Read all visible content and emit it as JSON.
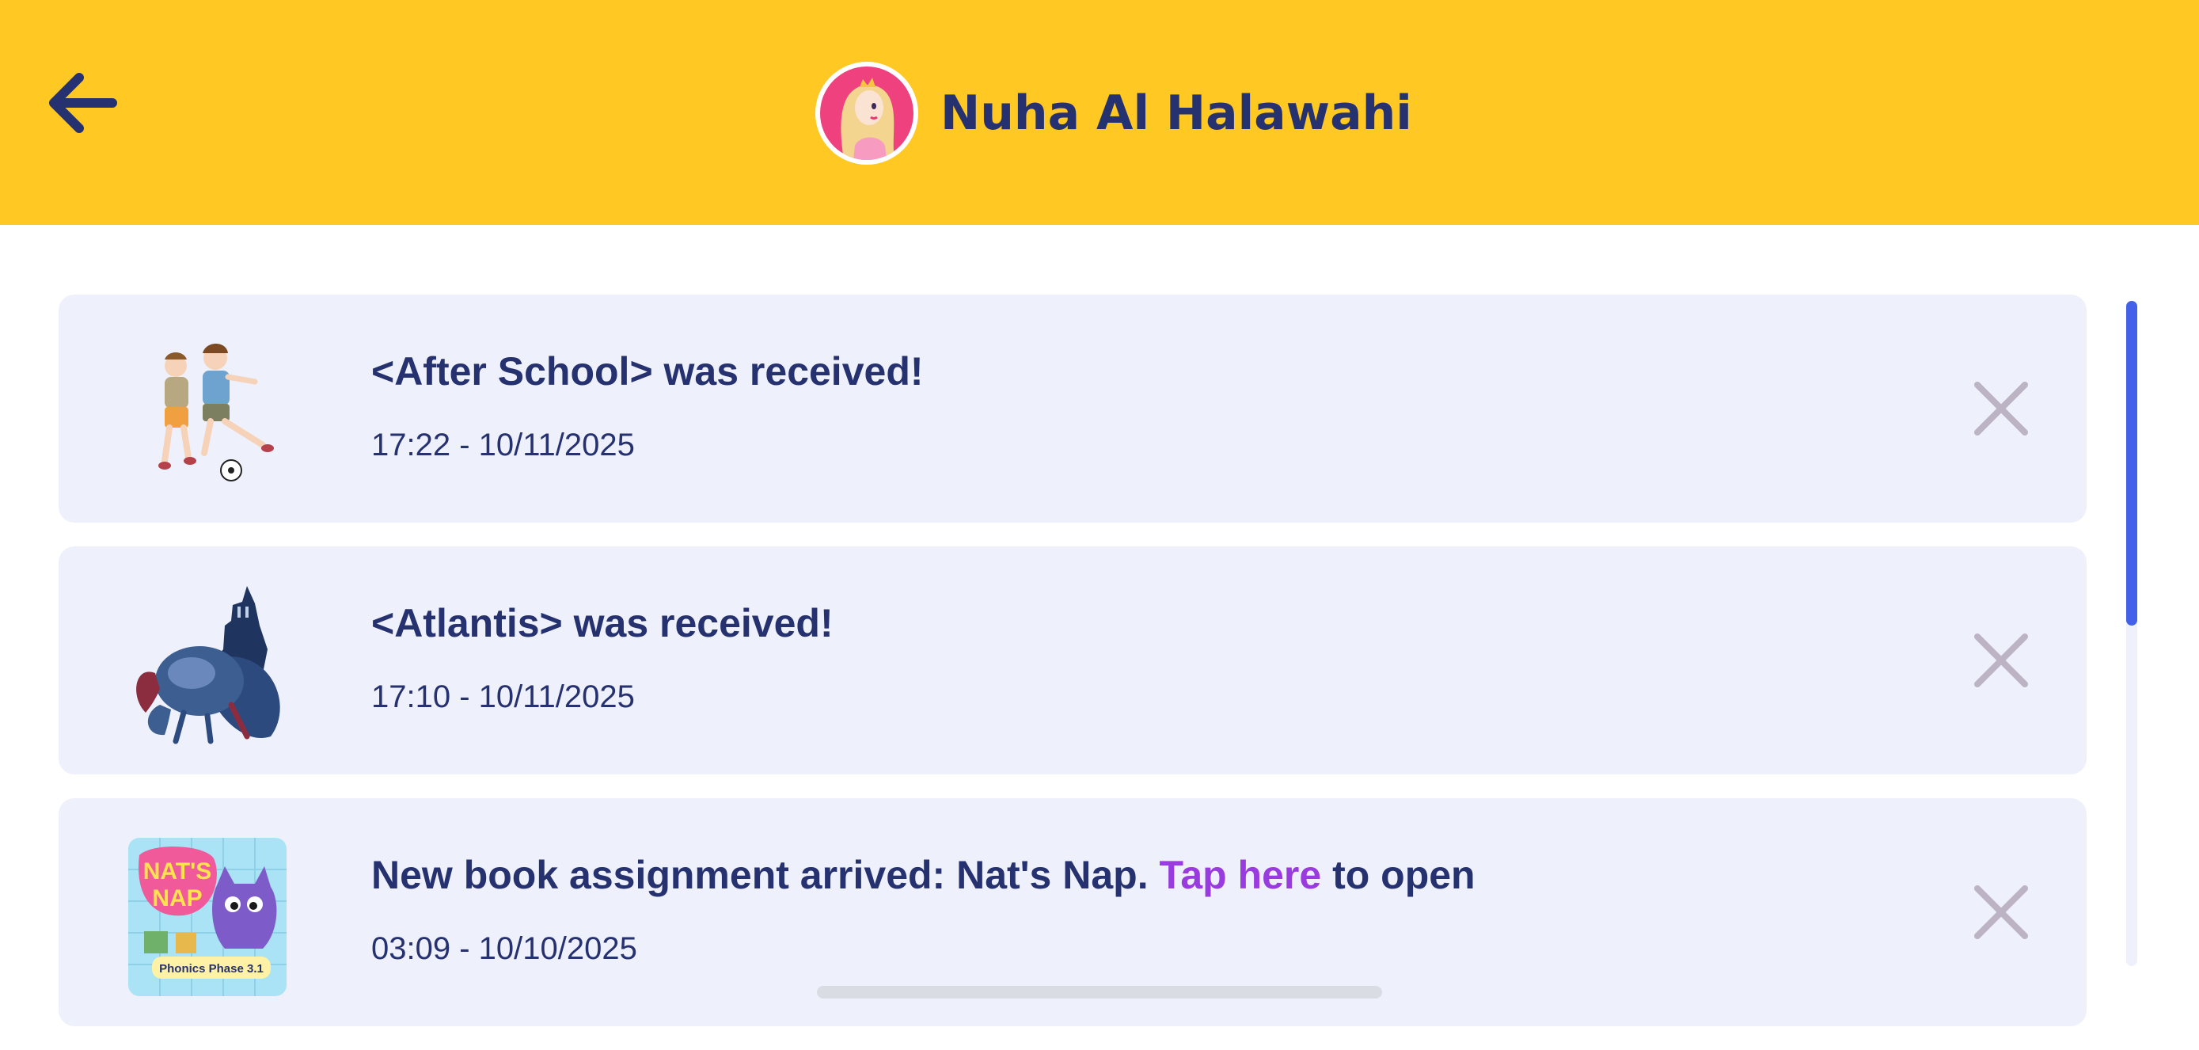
{
  "header": {
    "back_icon": "arrow-left-icon",
    "profile_name": "Nuha Al Halawahi",
    "avatar_icon": "princess-avatar-icon",
    "background_color": "#FFC823",
    "text_color": "#26316F"
  },
  "notifications": [
    {
      "title": "<After School> was received!",
      "time": "17:22 - 10/11/2025",
      "thumbnail_icon": "kids-playing-soccer-icon",
      "close_icon": "close-x-icon"
    },
    {
      "title": "<Atlantis> was received!",
      "time": "17:10 - 10/11/2025",
      "thumbnail_icon": "crab-lighthouse-icon",
      "close_icon": "close-x-icon"
    },
    {
      "title_prefix": "New book assignment arrived: Nat's Nap. ",
      "title_link": "Tap here",
      "title_suffix": " to open",
      "time": "03:09 - 10/10/2025",
      "book_cover_title": "NAT'S NAP",
      "book_cover_subtitle": "Phonics Phase 3.1",
      "thumbnail_icon": "book-cover-icon",
      "close_icon": "close-x-icon"
    }
  ],
  "colors": {
    "card_background": "#EEF1FB",
    "link": "#9A3BE0",
    "close_icon": "#BCB3C5",
    "scroll_thumb": "#4260E8"
  }
}
